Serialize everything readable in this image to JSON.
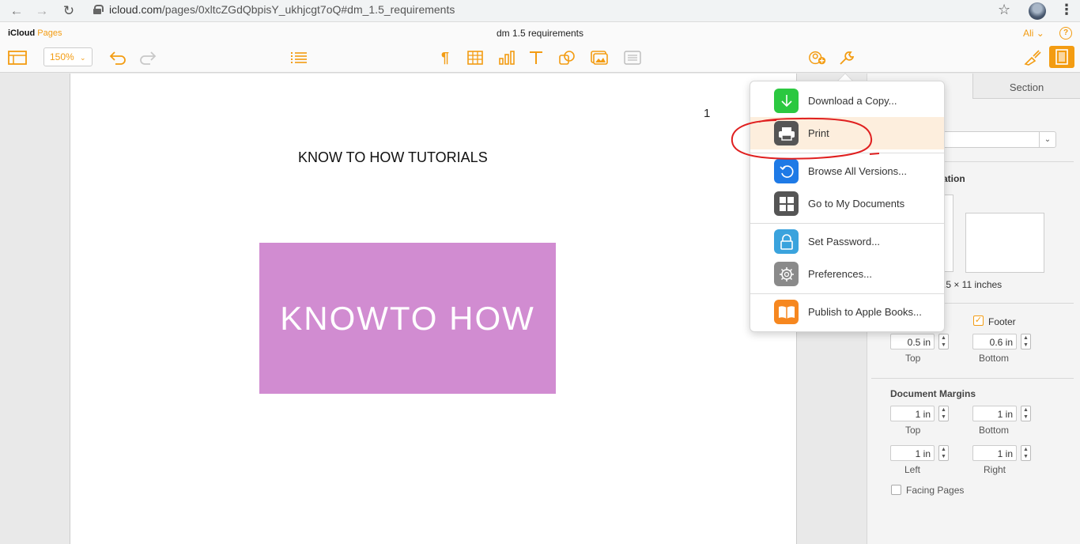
{
  "browser": {
    "url_host": "icloud.com",
    "url_path": "/pages/0xltcZGdQbpisY_ukhjcgt7oQ#dm_1.5_requirements"
  },
  "app": {
    "brand_main": "iCloud",
    "brand_sub": "Pages",
    "doc_title": "dm 1.5 requirements",
    "user": "Ali",
    "user_caret": "⌄",
    "help": "?"
  },
  "toolbar": {
    "zoom": "150%"
  },
  "document": {
    "page_number": "1",
    "heading": "KNOW TO HOW TUTORIALS",
    "banner_text": "KNOWTO HOW"
  },
  "menu": {
    "items": [
      {
        "label": "Download a Copy...",
        "icon": "download-icon",
        "color": "#2bc840"
      },
      {
        "label": "Print",
        "icon": "printer-icon",
        "color": "#555555"
      },
      {
        "label": "Browse All Versions...",
        "icon": "history-icon",
        "color": "#1e7ae6"
      },
      {
        "label": "Go to My Documents",
        "icon": "grid-icon",
        "color": "#555555"
      },
      {
        "label": "Set Password...",
        "icon": "lock-icon",
        "color": "#3aa3dd"
      },
      {
        "label": "Preferences...",
        "icon": "gear-icon",
        "color": "#8a8a8a"
      },
      {
        "label": "Publish to Apple Books...",
        "icon": "book-icon",
        "color": "#f6871f"
      }
    ]
  },
  "sidebar": {
    "tab_section": "Section",
    "orientation_label": "ation",
    "paper_size": ".5 × 11 inches",
    "footer_label": "Footer",
    "header_top": "0.5 in",
    "footer_bottom": "0.6 in",
    "top_label": "Top",
    "bottom_label": "Bottom",
    "doc_margins_title": "Document Margins",
    "margin_top": "1 in",
    "margin_bottom": "1 in",
    "margin_left": "1 in",
    "margin_right": "1 in",
    "left_label": "Left",
    "right_label": "Right",
    "facing_pages": "Facing Pages"
  },
  "colors": {
    "accent": "#f39c12",
    "banner": "#d18cd1"
  }
}
